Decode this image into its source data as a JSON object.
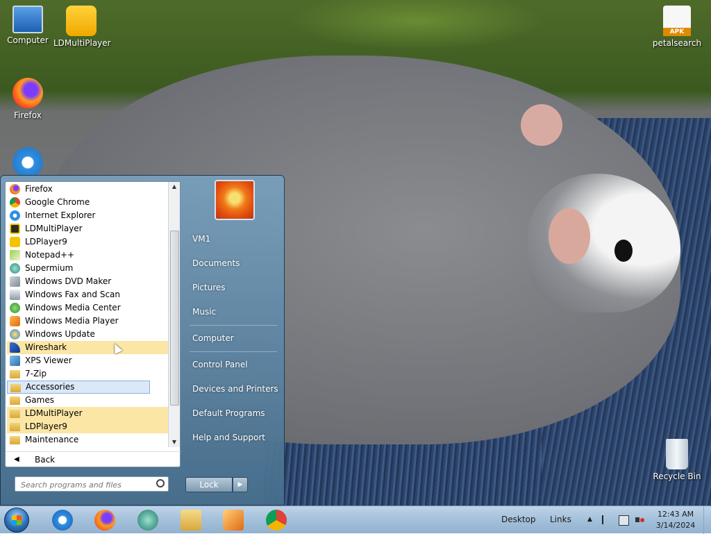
{
  "desktop_icons": [
    {
      "name": "Computer"
    },
    {
      "name": "LDMultiPlayer"
    },
    {
      "name": "Firefox"
    },
    {
      "name": "petalsearch",
      "badge": "APK"
    },
    {
      "name": "Recycle Bin"
    }
  ],
  "start_menu": {
    "programs": [
      {
        "label": "Firefox",
        "icon": "firefox-icon"
      },
      {
        "label": "Google Chrome",
        "icon": "chrome-icon"
      },
      {
        "label": "Internet Explorer",
        "icon": "ie-icon"
      },
      {
        "label": "LDMultiPlayer",
        "icon": "ldmultiplayer-icon"
      },
      {
        "label": "LDPlayer9",
        "icon": "ldplayer-icon"
      },
      {
        "label": "Notepad++",
        "icon": "notepad-icon"
      },
      {
        "label": "Supermium",
        "icon": "supermium-icon"
      },
      {
        "label": "Windows DVD Maker",
        "icon": "dvd-maker-icon"
      },
      {
        "label": "Windows Fax and Scan",
        "icon": "fax-icon"
      },
      {
        "label": "Windows Media Center",
        "icon": "media-center-icon"
      },
      {
        "label": "Windows Media Player",
        "icon": "media-player-icon"
      },
      {
        "label": "Windows Update",
        "icon": "windows-update-icon"
      },
      {
        "label": "Wireshark",
        "icon": "wireshark-icon",
        "state": "highlighted"
      },
      {
        "label": "XPS Viewer",
        "icon": "xps-icon"
      },
      {
        "label": "7-Zip",
        "icon": "folder-icon"
      },
      {
        "label": "Accessories",
        "icon": "folder-icon",
        "state": "selected"
      },
      {
        "label": "Games",
        "icon": "folder-icon"
      },
      {
        "label": "LDMultiPlayer",
        "icon": "folder-icon",
        "state": "highlighted"
      },
      {
        "label": "LDPlayer9",
        "icon": "folder-icon",
        "state": "highlighted"
      },
      {
        "label": "Maintenance",
        "icon": "folder-icon"
      }
    ],
    "back_label": "Back",
    "search_placeholder": "Search programs and files",
    "right_items": {
      "user": "VM1",
      "documents": "Documents",
      "pictures": "Pictures",
      "music": "Music",
      "computer": "Computer",
      "control_panel": "Control Panel",
      "devices": "Devices and Printers",
      "default_programs": "Default Programs",
      "help": "Help and Support"
    },
    "lock_label": "Lock"
  },
  "taskbar": {
    "pinned": [
      "ie-icon",
      "firefox-icon",
      "supermium-icon",
      "explorer-icon",
      "media-player-icon",
      "chrome-icon"
    ],
    "toolbars": {
      "desktop": "Desktop",
      "links": "Links"
    },
    "clock": {
      "time": "12:43 AM",
      "date": "3/14/2024"
    }
  },
  "colors": {
    "highlight": "#fbe6a6",
    "selected": "#dbe8f7",
    "taskbar": "#a6c2dc"
  }
}
